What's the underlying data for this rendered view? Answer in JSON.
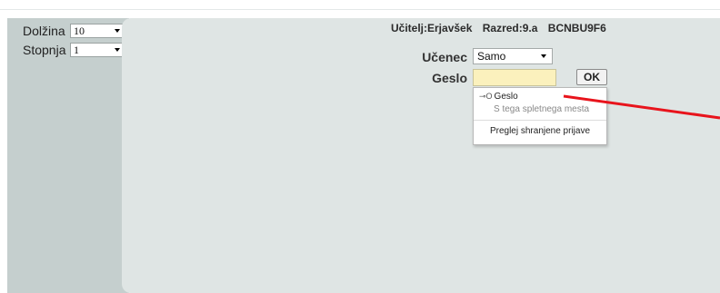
{
  "sidebar": {
    "dolzina": {
      "label": "Dolžina",
      "value": "10"
    },
    "stopnja": {
      "label": "Stopnja",
      "value": "1"
    }
  },
  "header": {
    "teacher": "Učitelj:Erjavšek",
    "class": "Razred:9.a",
    "code": "BCNBU9F6"
  },
  "form": {
    "ucenec_label": "Učenec",
    "ucenec_value": "Samo",
    "geslo_label": "Geslo",
    "geslo_value": "",
    "ok_label": "OK"
  },
  "autocomplete": {
    "key_icon": "key-icon",
    "item_label": "Geslo",
    "item_sub": "S tega spletnega mesta",
    "manage_label": "Preglej shranjene prijave"
  },
  "annotation": {
    "arrow_color": "#e8141c"
  }
}
